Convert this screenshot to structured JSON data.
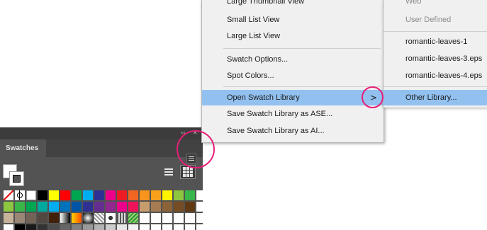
{
  "swatches_panel": {
    "tab_label": "Swatches",
    "collapse_glyph": "‹‹",
    "close_glyph": "✕",
    "swatch_rows": [
      [
        "none",
        "reg",
        "white",
        "#000000",
        "#ffff00",
        "#ff0000",
        "#00a651",
        "#00aeef",
        "#2e3192",
        "#ec008c",
        "#ed1c24",
        "#f26522",
        "#f7941d",
        "#f9a01b",
        "#fff200",
        "#8dc63f",
        "#39b54a",
        "#ffffff"
      ],
      [
        "#8dc63f",
        "#39b54a",
        "#00a651",
        "#00a99d",
        "#00aeef",
        "#0072bc",
        "#0054a6",
        "#2e3192",
        "#662d91",
        "#92278f",
        "#ec008c",
        "#ed145b",
        "#c69c6d",
        "#a67c52",
        "#8c6239",
        "#754c24",
        "#603913",
        "#ffffff"
      ],
      [
        "#c7b299",
        "#998675",
        "#736357",
        "#534741",
        "#42210b",
        "grad1",
        "grad2",
        "grad3",
        "pat1",
        "pat2",
        "pat3",
        "pat4",
        "#ffffff",
        "#ffffff",
        "#ffffff",
        "#ffffff",
        "#ffffff",
        "#ffffff"
      ],
      [
        "#ffffff",
        "#000000",
        "#1a1a1a",
        "#333333",
        "#4d4d4d",
        "#666666",
        "#808080",
        "#999999",
        "#b3b3b3",
        "#cccccc",
        "#e6e6e6",
        "#f2f2f2",
        "#ffffff",
        "#ffffff",
        "#ffffff",
        "#ffffff",
        "#ffffff",
        "#ffffff"
      ]
    ]
  },
  "main_menu": {
    "items": [
      {
        "label": "Large Thumbnail View"
      },
      {
        "label": "Small List View"
      },
      {
        "label": "Large List View"
      },
      {
        "label": "Swatch Options..."
      },
      {
        "label": "Spot Colors..."
      },
      {
        "label": "Open Swatch Library",
        "arrow": ">"
      },
      {
        "label": "Save Swatch Library as ASE..."
      },
      {
        "label": "Save Swatch Library as AI..."
      }
    ]
  },
  "sub_menu": {
    "items": [
      {
        "label": "Web"
      },
      {
        "label": "User Defined"
      },
      {
        "label": "romantic-leaves-1"
      },
      {
        "label": "romantic-leaves-3.eps"
      },
      {
        "label": "romantic-leaves-4.eps"
      },
      {
        "label": "Other Library..."
      }
    ]
  },
  "colors": {
    "highlight": "#92c1f0",
    "annotation": "#e61e78",
    "panel_bg": "#535353"
  }
}
